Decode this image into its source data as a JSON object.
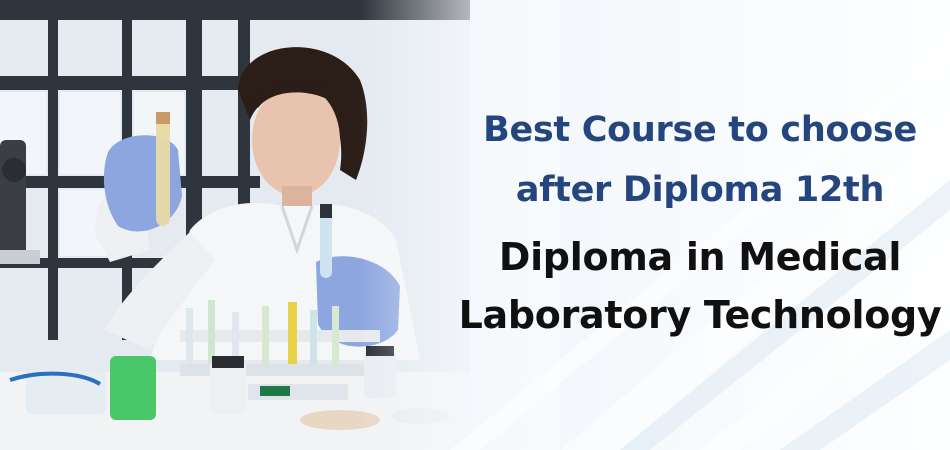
{
  "banner": {
    "headline_line1": "Best Course to choose",
    "headline_line2": "after Diploma 12th",
    "subtitle_line1": "Diploma in Medical",
    "subtitle_line2": "Laboratory Technology"
  },
  "colors": {
    "headline": "#24457d",
    "subtitle": "#101010",
    "background": "#eef4fa",
    "glove": "#8ea6e0",
    "coat": "#f5f6f8"
  }
}
